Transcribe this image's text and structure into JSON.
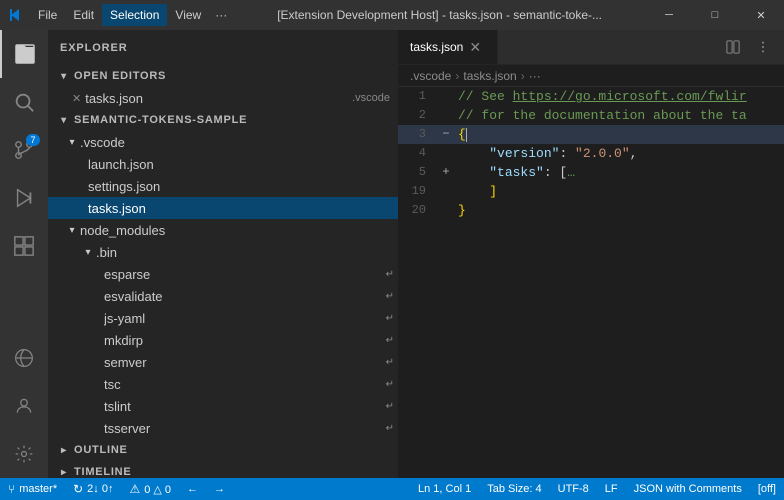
{
  "titlebar": {
    "icon_color": "#0078d4",
    "menus": [
      "File",
      "Edit",
      "Selection",
      "View",
      "···"
    ],
    "title": "[Extension Development Host] - tasks.json - semantic-toke-...",
    "controls": [
      "─",
      "□",
      "✕"
    ],
    "selection_active": true
  },
  "activitybar": {
    "items": [
      {
        "name": "explorer",
        "icon": "📄",
        "active": true,
        "badge": null
      },
      {
        "name": "search",
        "icon": "🔍",
        "active": false,
        "badge": null
      },
      {
        "name": "source-control",
        "icon": "⑂",
        "active": false,
        "badge": "7"
      },
      {
        "name": "run",
        "icon": "▶",
        "active": false,
        "badge": null
      },
      {
        "name": "extensions",
        "icon": "⬛",
        "active": false,
        "badge": null
      }
    ],
    "bottom": [
      {
        "name": "remote",
        "icon": "⚙"
      },
      {
        "name": "account",
        "icon": "👤"
      },
      {
        "name": "settings",
        "icon": "⚙"
      }
    ]
  },
  "sidebar": {
    "title": "Explorer",
    "sections": {
      "open_editors": {
        "label": "Open Editors",
        "expanded": true,
        "items": [
          {
            "name": "tasks.json",
            "suffix": ".vscode",
            "dirty": true,
            "active": false
          }
        ]
      },
      "semantic_tokens": {
        "label": "Semantic-Tokens-Sample",
        "expanded": true,
        "vscode_folder": {
          "name": ".vscode",
          "expanded": true,
          "items": [
            {
              "name": "launch.json",
              "indent": 2
            },
            {
              "name": "settings.json",
              "indent": 2
            },
            {
              "name": "tasks.json",
              "indent": 2,
              "selected": true
            }
          ]
        },
        "node_modules": {
          "name": "node_modules",
          "expanded": true,
          "bin_folder": {
            "name": ".bin",
            "expanded": true,
            "items": [
              {
                "name": "esparse",
                "has_arrow": true
              },
              {
                "name": "esvalidate",
                "has_arrow": true
              },
              {
                "name": "js-yaml",
                "has_arrow": true
              },
              {
                "name": "mkdirp",
                "has_arrow": true
              },
              {
                "name": "semver",
                "has_arrow": true
              },
              {
                "name": "tsc",
                "has_arrow": true
              },
              {
                "name": "tslint",
                "has_arrow": true
              },
              {
                "name": "tsserver",
                "has_arrow": true
              }
            ]
          }
        }
      },
      "outline": {
        "label": "Outline",
        "expanded": false
      },
      "timeline": {
        "label": "Timeline",
        "expanded": false
      }
    }
  },
  "editor": {
    "tab": {
      "name": "tasks.json",
      "active": true
    },
    "breadcrumb": [
      ".vscode",
      "tasks.json",
      "···"
    ],
    "lines": [
      {
        "num": 1,
        "content_html": "<span class='token-comment'>// See </span><span class='token-link'>https://go.microsoft.com/fwlir</span>",
        "gutter": ""
      },
      {
        "num": 2,
        "content_html": "<span class='token-comment'>// for the documentation about the ta</span>",
        "gutter": ""
      },
      {
        "num": 3,
        "content_html": "<span class='token-bracket'>{</span>",
        "gutter": "−",
        "collapse": true
      },
      {
        "num": 4,
        "content_html": "    <span class='token-key'>\"version\"</span><span class='token-punc'>: </span><span class='token-string'>\"2.0.0\"</span><span class='token-punc'>,</span>",
        "gutter": ""
      },
      {
        "num": 5,
        "content_html": "<span class='token-punc'>+</span>    <span class='token-key'>\"tasks\"</span><span class='token-punc'>: [</span><span class='token-comment'>…</span>",
        "gutter": "+",
        "collapse": true
      },
      {
        "num": 19,
        "content_html": "    <span class='token-bracket'>]</span>",
        "gutter": ""
      },
      {
        "num": 20,
        "content_html": "<span class='token-bracket'>}</span>",
        "gutter": ""
      }
    ]
  },
  "statusbar": {
    "left": [
      {
        "icon": "⑂",
        "label": "master*"
      },
      {
        "icon": "↻",
        "label": "2↓ 0↑"
      },
      {
        "icon": "⚠",
        "label": "0  △ 0"
      }
    ],
    "nav": [
      "←",
      "→"
    ],
    "right": [
      {
        "label": "Ln 1, Col 1"
      },
      {
        "label": "Tab Size: 4"
      },
      {
        "label": "UTF-8"
      },
      {
        "label": "LF"
      },
      {
        "label": "JSON with Comments"
      },
      {
        "label": "[off]"
      }
    ]
  }
}
